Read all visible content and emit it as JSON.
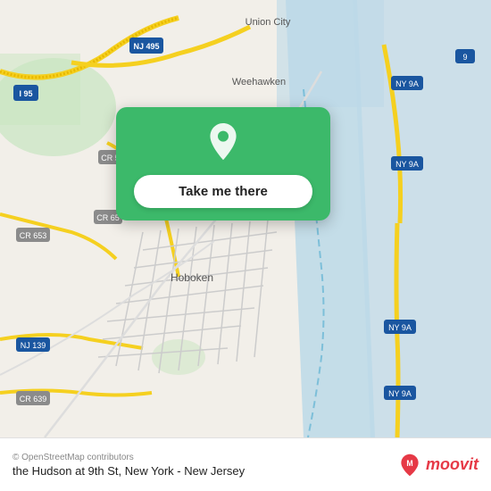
{
  "map": {
    "background_color": "#e8e0d8",
    "center_city": "Hoboken",
    "region": "New Jersey"
  },
  "card": {
    "button_label": "Take me there",
    "pin_color": "#ffffff"
  },
  "bottom_bar": {
    "copyright": "© OpenStreetMap contributors",
    "location_name": "the Hudson at 9th St, New York - New Jersey",
    "brand_name": "moovit"
  }
}
